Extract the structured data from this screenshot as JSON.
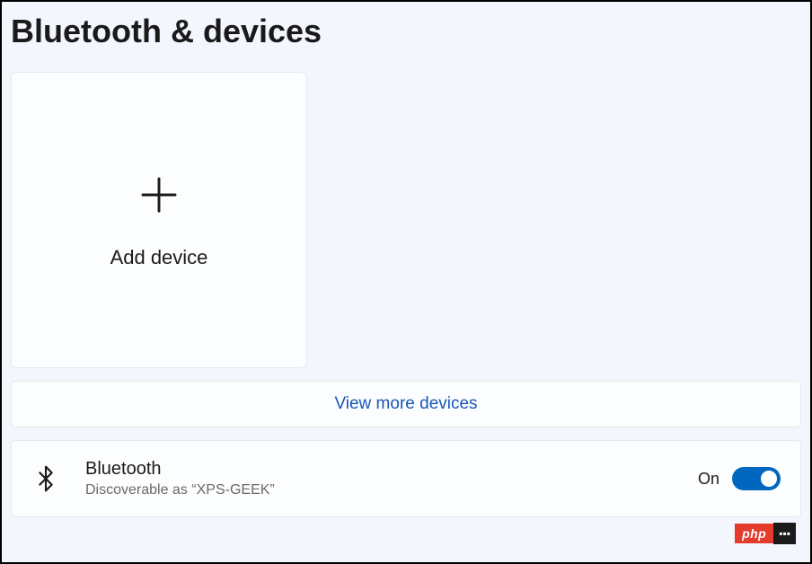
{
  "title": "Bluetooth & devices",
  "add_device": {
    "label": "Add device"
  },
  "view_more": {
    "label": "View more devices"
  },
  "bluetooth": {
    "title": "Bluetooth",
    "subtitle": "Discoverable as “XPS-GEEK”",
    "state_label": "On",
    "state": true
  },
  "watermark": {
    "text": "php"
  }
}
